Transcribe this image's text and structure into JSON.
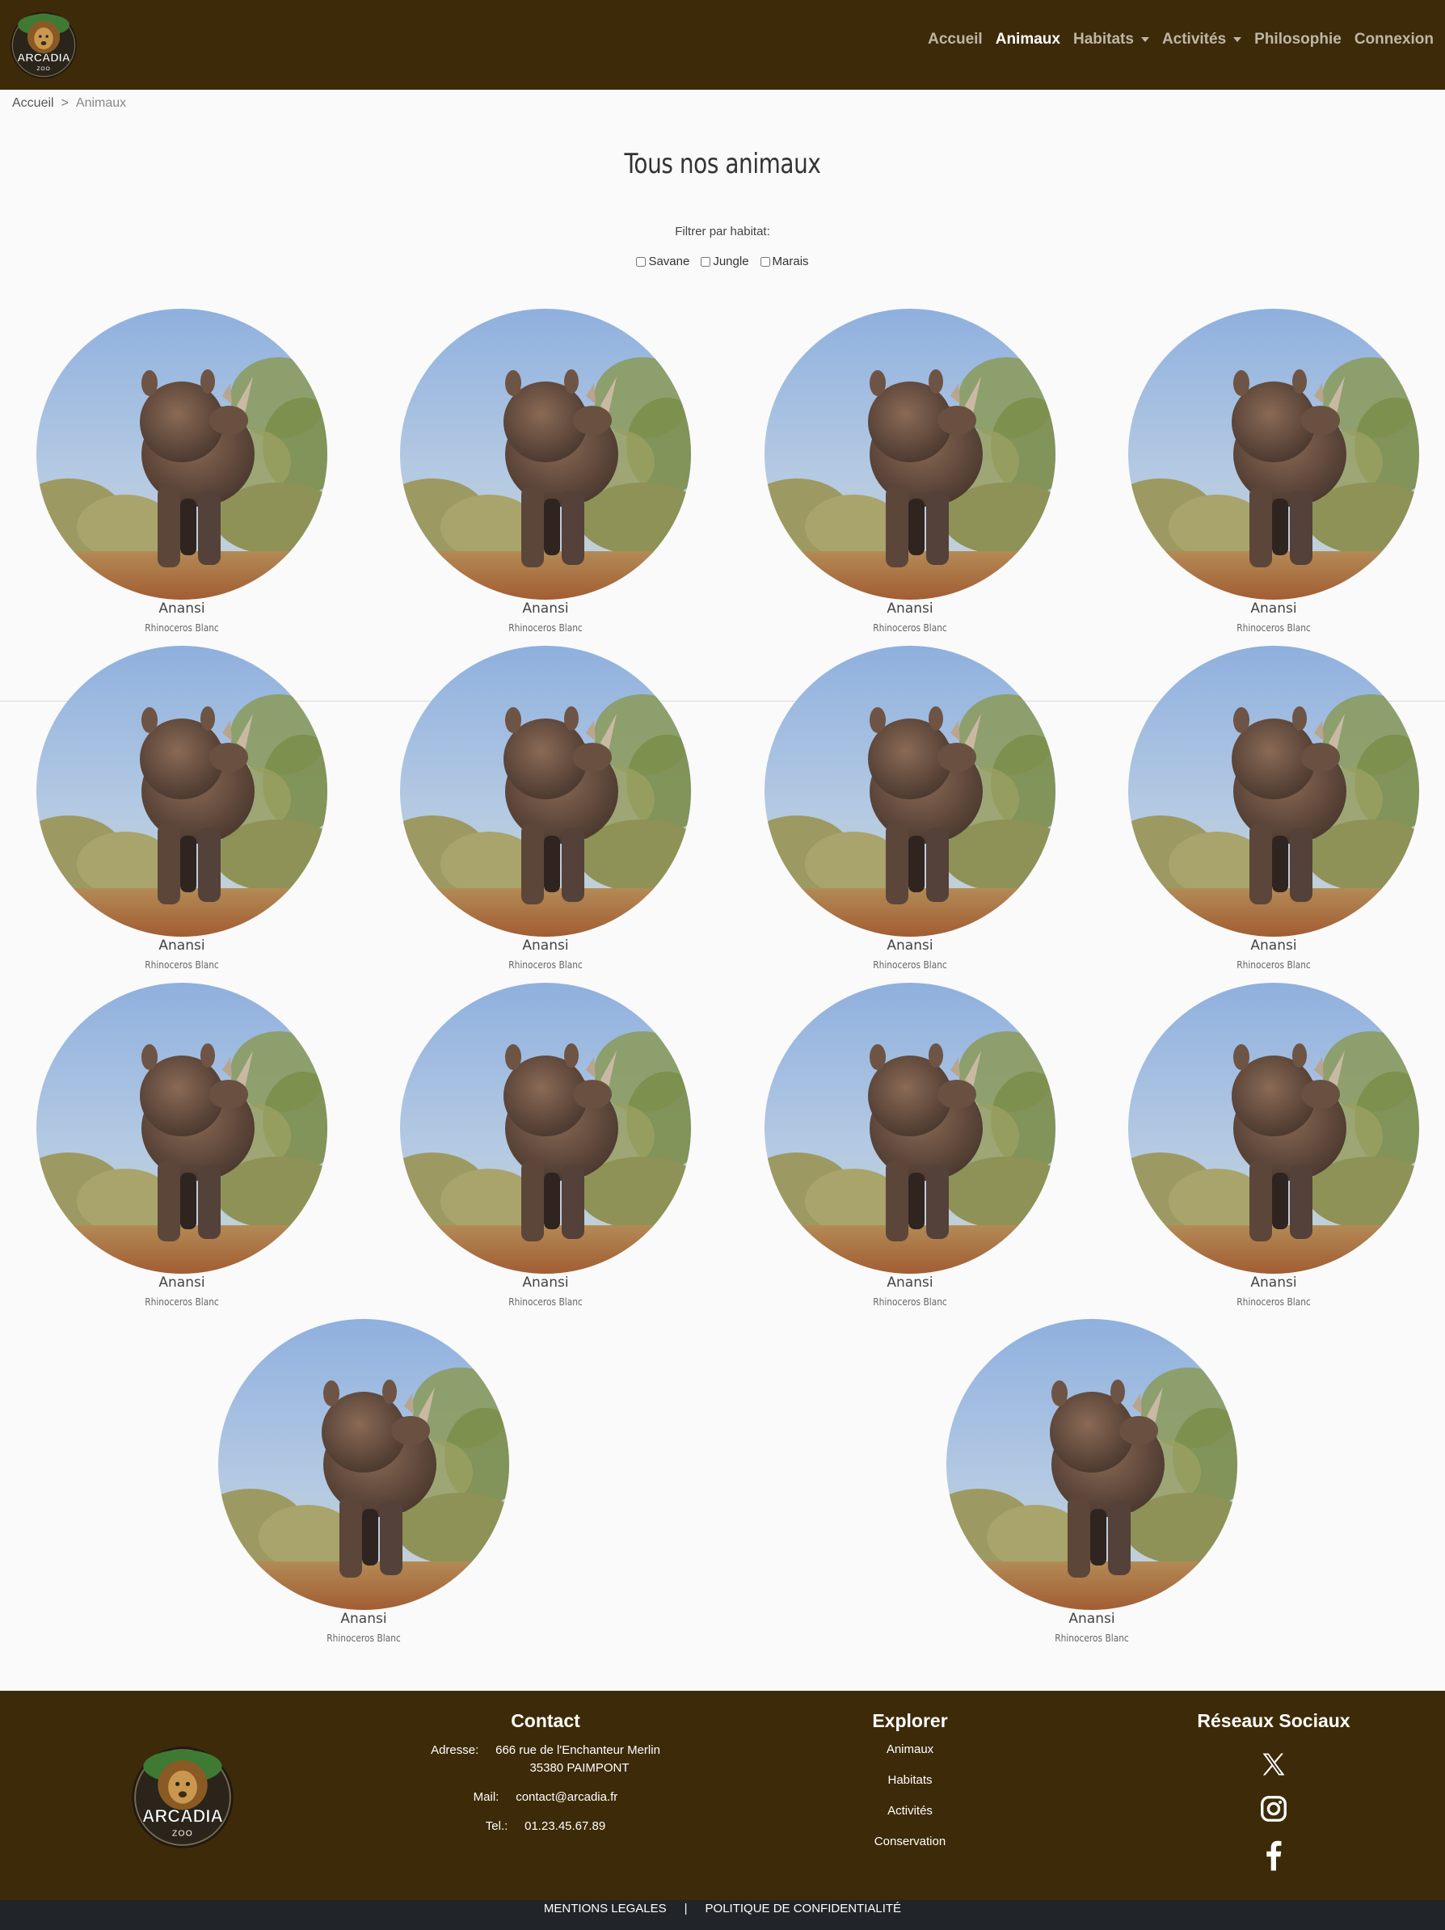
{
  "header": {
    "logo_text": "ARCADIA",
    "logo_sub": "ZOO",
    "nav": [
      {
        "label": "Accueil",
        "active": false,
        "dropdown": false
      },
      {
        "label": "Animaux",
        "active": true,
        "dropdown": false
      },
      {
        "label": "Habitats",
        "active": false,
        "dropdown": true
      },
      {
        "label": "Activités",
        "active": false,
        "dropdown": true
      },
      {
        "label": "Philosophie",
        "active": false,
        "dropdown": false
      },
      {
        "label": "Connexion",
        "active": false,
        "dropdown": false
      }
    ]
  },
  "breadcrumb": {
    "home": "Accueil",
    "separator": ">",
    "current": "Animaux"
  },
  "page": {
    "title": "Tous nos animaux",
    "filter_label": "Filtrer par habitat:",
    "filters": [
      {
        "label": "Savane",
        "checked": false
      },
      {
        "label": "Jungle",
        "checked": false
      },
      {
        "label": "Marais",
        "checked": false
      }
    ]
  },
  "animals": [
    {
      "name": "Anansi",
      "species": "Rhinoceros Blanc"
    },
    {
      "name": "Anansi",
      "species": "Rhinoceros Blanc"
    },
    {
      "name": "Anansi",
      "species": "Rhinoceros Blanc"
    },
    {
      "name": "Anansi",
      "species": "Rhinoceros Blanc"
    },
    {
      "name": "Anansi",
      "species": "Rhinoceros Blanc"
    },
    {
      "name": "Anansi",
      "species": "Rhinoceros Blanc"
    },
    {
      "name": "Anansi",
      "species": "Rhinoceros Blanc"
    },
    {
      "name": "Anansi",
      "species": "Rhinoceros Blanc"
    },
    {
      "name": "Anansi",
      "species": "Rhinoceros Blanc"
    },
    {
      "name": "Anansi",
      "species": "Rhinoceros Blanc"
    },
    {
      "name": "Anansi",
      "species": "Rhinoceros Blanc"
    },
    {
      "name": "Anansi",
      "species": "Rhinoceros Blanc"
    },
    {
      "name": "Anansi",
      "species": "Rhinoceros Blanc"
    },
    {
      "name": "Anansi",
      "species": "Rhinoceros Blanc"
    }
  ],
  "footer": {
    "contact": {
      "title": "Contact",
      "address_label": "Adresse:",
      "address_line1": "666 rue de l'Enchanteur Merlin",
      "address_line2": "35380 PAIMPONT",
      "mail_label": "Mail:",
      "mail": "contact@arcadia.fr",
      "tel_label": "Tel.:",
      "tel": "01.23.45.67.89"
    },
    "explore": {
      "title": "Explorer",
      "links": [
        "Animaux",
        "Habitats",
        "Activités",
        "Conservation"
      ]
    },
    "social": {
      "title": "Réseaux Sociaux",
      "icons": [
        "x-icon",
        "instagram-icon",
        "facebook-icon"
      ]
    },
    "bottom": {
      "legal": "MENTIONS LEGALES",
      "sep": "|",
      "privacy": "POLITIQUE DE CONFIDENTIALITÉ"
    }
  },
  "colors": {
    "header_bg": "#3d2a08",
    "bottom_bar": "#212529",
    "page_bg": "#fafafa"
  }
}
